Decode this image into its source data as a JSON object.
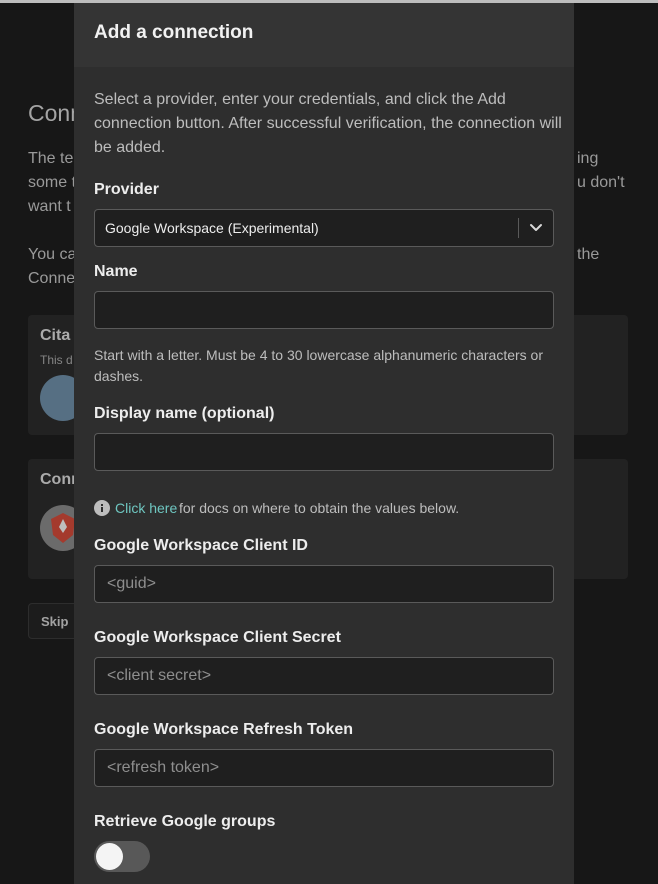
{
  "background": {
    "heading": "Conn",
    "paragraph1_line1_left": "The te",
    "paragraph1_line1_right": "ing",
    "paragraph1_line2_left": "some t",
    "paragraph1_line2_right": "u don't",
    "paragraph1_line3_left": "want t",
    "paragraph2_line1_left": "You ca",
    "paragraph2_line1_right": "the",
    "paragraph2_line2_left": "Conne",
    "card1_title": "Cita",
    "card1_subtitle": "This d",
    "card2_title": "Conn",
    "skip_label": "Skip"
  },
  "modal": {
    "title": "Add a connection",
    "intro": "Select a provider, enter your credentials, and click the Add connection button. After successful verification, the connection will be added.",
    "provider": {
      "label": "Provider",
      "value": "Google Workspace (Experimental)"
    },
    "name": {
      "label": "Name",
      "value": "",
      "placeholder": "",
      "help": "Start with a letter. Must be 4 to 30 lowercase alphanumeric characters or dashes."
    },
    "display_name": {
      "label": "Display name (optional)",
      "value": "",
      "placeholder": ""
    },
    "docs": {
      "link_text": "Click here",
      "text": "for docs on where to obtain the values below."
    },
    "client_id": {
      "label": "Google Workspace Client ID",
      "placeholder": "<guid>"
    },
    "client_secret": {
      "label": "Google Workspace Client Secret",
      "placeholder": "<client secret>"
    },
    "refresh_token": {
      "label": "Google Workspace Refresh Token",
      "placeholder": "<refresh token>"
    },
    "retrieve_groups": {
      "label": "Retrieve Google groups",
      "enabled": false
    }
  },
  "colors": {
    "accent_link": "#6fc7c1",
    "modal_bg": "#2e2e2e",
    "page_bg": "#1e1e1e"
  },
  "icons": [
    "chevron-down-icon",
    "info-icon"
  ]
}
